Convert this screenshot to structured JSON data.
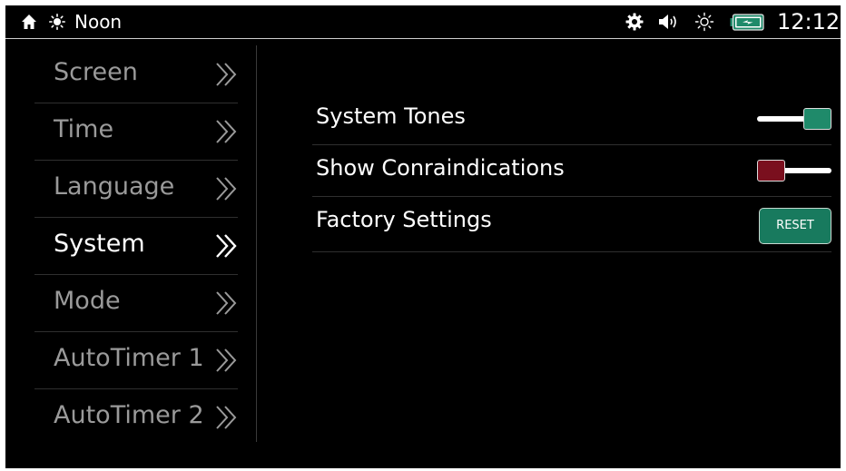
{
  "status_bar": {
    "time_of_day": "Noon",
    "clock": "12:12",
    "icons": [
      "home-icon",
      "sun-icon",
      "gear-icon",
      "volume-icon",
      "brightness-icon",
      "battery-charging-icon"
    ]
  },
  "sidebar": {
    "items": [
      {
        "label": "Screen",
        "active": false
      },
      {
        "label": "Time",
        "active": false
      },
      {
        "label": "Language",
        "active": false
      },
      {
        "label": "System",
        "active": true
      },
      {
        "label": "Mode",
        "active": false
      },
      {
        "label": "AutoTimer 1",
        "active": false
      },
      {
        "label": "AutoTimer 2",
        "active": false
      }
    ]
  },
  "settings": {
    "system_tones": {
      "label": "System Tones",
      "enabled": true
    },
    "show_contraindications": {
      "label": "Show Conraindications",
      "enabled": false
    },
    "factory_settings": {
      "label": "Factory Settings",
      "button_label": "RESET"
    }
  },
  "colors": {
    "background": "#000000",
    "toggle_on": "#1f8a6a",
    "toggle_off": "#7a0f1e",
    "button": "#187a5e",
    "menu_inactive_text": "#9a9a9a",
    "menu_active_text": "#ffffff"
  }
}
